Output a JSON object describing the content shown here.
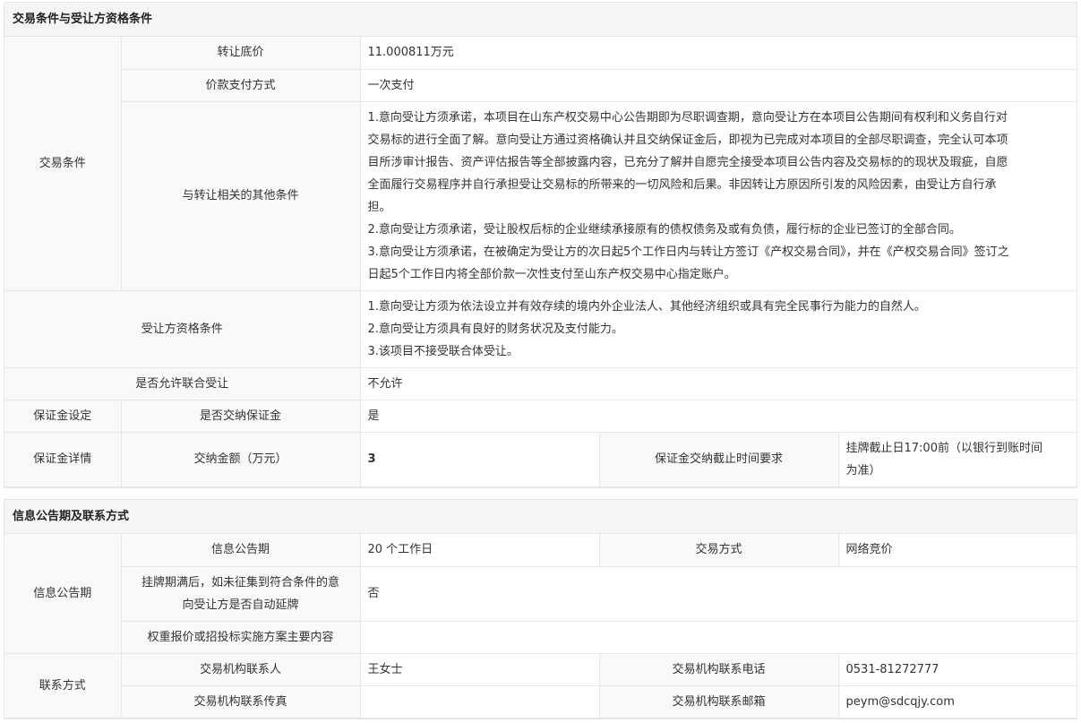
{
  "section1": {
    "title": "交易条件与受让方资格条件",
    "trade_conditions_label": "交易条件",
    "transfer_floor_price_label": "转让底价",
    "transfer_floor_price_value": "11.000811万元",
    "payment_method_label": "价款支付方式",
    "payment_method_value": "一次支付",
    "other_conditions_label": "与转让相关的其他条件",
    "other_conditions_lines": [
      "1.意向受让方须承诺，本项目在山东产权交易中心公告期即为尽职调查期，意向受让方在本项目公告期间有权利和义务自行对",
      "交易标的进行全面了解。意向受让方通过资格确认并且交纳保证金后，即视为已完成对本项目的全部尽职调查，完全认可本项",
      "目所涉审计报告、资产评估报告等全部披露内容，已充分了解并自愿完全接受本项目公告内容及交易标的的现状及瑕疵，自愿",
      "全面履行交易程序并自行承担受让交易标的所带来的一切风险和后果。非因转让方原因所引发的风险因素，由受让方自行承",
      "担。",
      "2.意向受让方须承诺，受让股权后标的企业继续承接原有的债权债务及或有负债，履行标的企业已签订的全部合同。",
      "3.意向受让方须承诺，在被确定为受让方的次日起5个工作日内与转让方签订《产权交易合同》，并在《产权交易合同》签订之",
      "日起5个工作日内将全部价款一次性支付至山东产权交易中心指定账户。"
    ],
    "qualification_label": "受让方资格条件",
    "qualification_lines": [
      "1.意向受让方须为依法设立并有效存续的境内外企业法人、其他经济组织或具有完全民事行为能力的自然人。",
      "2.意向受让方须具有良好的财务状况及支付能力。",
      "3.该项目不接受联合体受让。"
    ],
    "joint_label": "是否允许联合受让",
    "joint_value": "不允许",
    "deposit_setting_label": "保证金设定",
    "deposit_required_label": "是否交纳保证金",
    "deposit_required_value": "是",
    "deposit_detail_label": "保证金详情",
    "deposit_amount_label": "交纳金额（万元）",
    "deposit_amount_value": "3",
    "deposit_deadline_label": "保证金交纳截止时间要求",
    "deposit_deadline_lines": [
      "挂牌截止日17:00前（以银行到账时间",
      "为准）"
    ]
  },
  "section2": {
    "title": "信息公告期及联系方式",
    "info_period_group_label": "信息公告期",
    "info_period_label": "信息公告期",
    "info_period_value": "20 个工作日",
    "trade_method_label": "交易方式",
    "trade_method_value": "网络竞价",
    "auto_extend_label_lines": [
      "挂牌期满后，如未征集到符合条件的意",
      "向受让方是否自动延牌"
    ],
    "auto_extend_value": "否",
    "weighted_label": "权重报价或招投标实施方案主要内容",
    "weighted_value": "",
    "contact_group_label": "联系方式",
    "contact_person_label": "交易机构联系人",
    "contact_person_value": "王女士",
    "contact_phone_label": "交易机构联系电话",
    "contact_phone_value": "0531-81272777",
    "fax_label": "交易机构联系传真",
    "fax_value": "",
    "email_label": "交易机构联系邮箱",
    "email_value": "peym@sdcqjy.com"
  }
}
